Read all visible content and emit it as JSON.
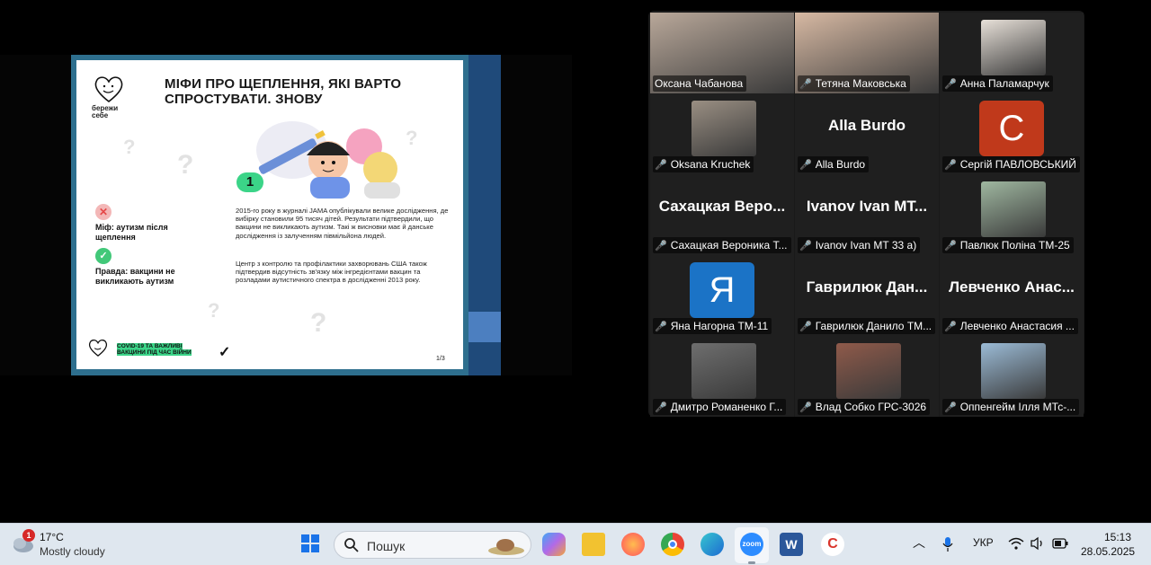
{
  "slide": {
    "logo_caption": "бережи\nсебе",
    "title": "МІФИ ПРО ЩЕПЛЕННЯ, ЯКІ ВАРТО СПРОСТУВАТИ. ЗНОВУ",
    "number": "1",
    "myth_icon": "✕",
    "myth": "Міф: аутизм після щеплення",
    "truth_icon": "✓",
    "truth": "Правда: вакцини не викликають аутизм",
    "body1": "2015-го року в журналі JAMA опублікували велике дослідження, де вибірку становили 95 тисяч дітей. Результати підтвердили, що вакцини не викликають аутизм. Такі ж висновки має й данське дослідження із залученням півмільйона людей.",
    "body2": "Центр з контролю та профілактики захворювань США також підтвердив відсутність зв'язку між інгредієнтами вакцин та розладами аутистичного спектра в дослідженні 2013 року.",
    "footer_label": "COVID-19 та важливі вакцини під час війни",
    "footer_mark": "✓",
    "page": "1/3"
  },
  "participants": [
    {
      "label": "Оксана Чабанова",
      "muted": false,
      "active": true,
      "type": "video",
      "color": "#b9a89a"
    },
    {
      "label": "Тетяна Маковська",
      "muted": true,
      "active": false,
      "type": "video",
      "color": "#d7b9a3"
    },
    {
      "label": "Анна Паламарчук",
      "muted": true,
      "active": false,
      "type": "video",
      "color": "#e7e0d8"
    },
    {
      "label": "Oksana Kruchek",
      "muted": true,
      "active": false,
      "type": "video",
      "color": "#9a8f83"
    },
    {
      "label": "Alla Burdo",
      "muted": true,
      "active": false,
      "type": "name",
      "big": "Alla Burdo"
    },
    {
      "label": "Сергій ПАВЛОВСЬКИЙ",
      "muted": true,
      "active": false,
      "type": "avatar",
      "letter": "C",
      "color": "#c0391b"
    },
    {
      "label": "Сахацкая Вероника Т...",
      "muted": true,
      "active": false,
      "type": "name",
      "big": "Сахацкая Веро..."
    },
    {
      "label": "Ivanov Ivan MT 33 a)",
      "muted": true,
      "active": false,
      "type": "name",
      "big": "Ivanov Ivan MT..."
    },
    {
      "label": "Павлюк Поліна ТМ-25",
      "muted": true,
      "active": false,
      "type": "video",
      "color": "#9fb7a0"
    },
    {
      "label": "Яна Нагорна ТМ-11",
      "muted": true,
      "active": false,
      "type": "avatar",
      "letter": "Я",
      "color": "#1b73c6"
    },
    {
      "label": "Гаврилюк Данило ТМ...",
      "muted": true,
      "active": false,
      "type": "name",
      "big": "Гаврилюк Дан..."
    },
    {
      "label": "Левченко Анастасия ...",
      "muted": true,
      "active": false,
      "type": "name",
      "big": "Левченко Анас..."
    },
    {
      "label": "Дмитро Романенко Г...",
      "muted": true,
      "active": false,
      "type": "video",
      "color": "#6e6e6e"
    },
    {
      "label": "Влад Собко ГРС-3026",
      "muted": true,
      "active": false,
      "type": "video",
      "color": "#8f5a4a"
    },
    {
      "label": "Оппенгейм Ілля МТс-...",
      "muted": true,
      "active": false,
      "type": "video",
      "color": "#9bbbd6"
    }
  ],
  "taskbar": {
    "weather_badge": "1",
    "temp": "17°C",
    "condition": "Mostly cloudy",
    "search_placeholder": "Пошук",
    "lang": "УКР",
    "time": "15:13",
    "date": "28.05.2025",
    "apps": [
      {
        "name": "windows-start-icon",
        "color": "#1a73e8"
      },
      {
        "name": "copilot-icon",
        "color": "#8e6be8"
      },
      {
        "name": "file-explorer-icon",
        "color": "#f2b705"
      },
      {
        "name": "firefox-icon",
        "color": "#ff7139"
      },
      {
        "name": "chrome-icon",
        "color": "#34a853"
      },
      {
        "name": "edge-icon",
        "color": "#1d9bd1"
      },
      {
        "name": "zoom-icon",
        "color": "#2d8cff",
        "text": "zoom"
      },
      {
        "name": "word-icon",
        "color": "#2b579a",
        "text": "W"
      },
      {
        "name": "ccleaner-icon",
        "color": "#d9342b"
      }
    ]
  }
}
